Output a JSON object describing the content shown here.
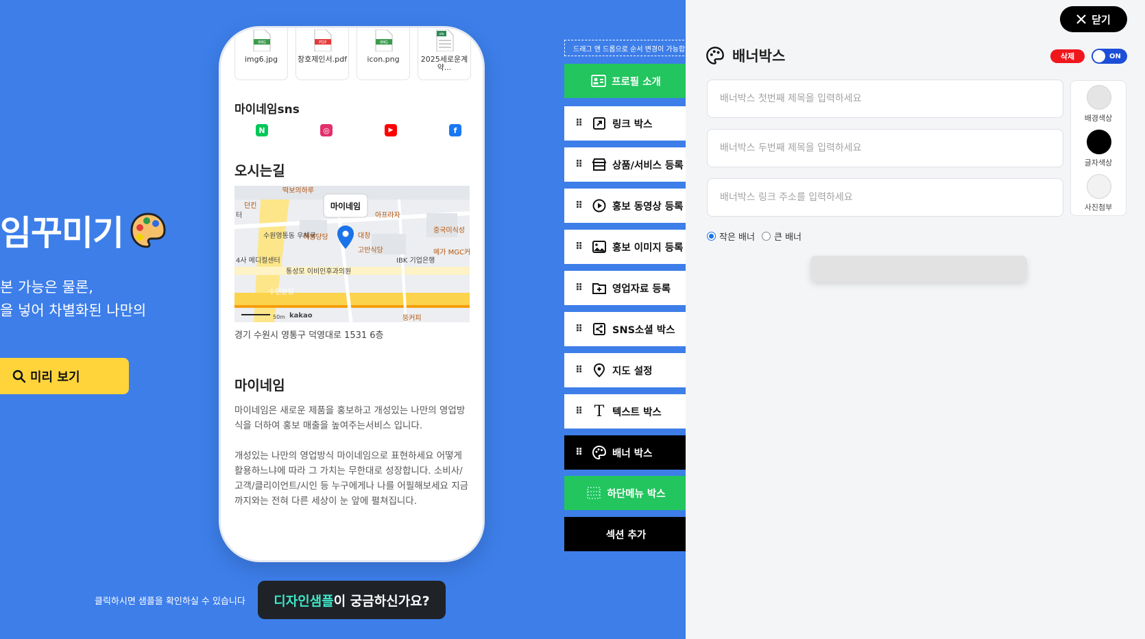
{
  "hero": {
    "title": "임꾸미기",
    "subtitle_line1": "본 가능은 물론,",
    "subtitle_line2": "을 넣어 차별화된 나만의",
    "preview_label": "미리 보기"
  },
  "phone": {
    "files": [
      {
        "name": "img6.jpg",
        "badge": "IMG",
        "color": "#3b9b4c"
      },
      {
        "name": "창호제인서.pdf",
        "badge": "PDF",
        "color": "#e23b3b"
      },
      {
        "name": "icon.png",
        "badge": "IMG",
        "color": "#3b9b4c"
      },
      {
        "name": "2025세로운계약...",
        "badge": "xls",
        "color": "#2e8b57"
      }
    ],
    "sns_title": "마이네임sns",
    "sns": [
      {
        "icon": "naver-icon",
        "glyph": "N",
        "color": "#03c75a"
      },
      {
        "icon": "instagram-icon",
        "glyph": "◎",
        "color": "#e1306c"
      },
      {
        "icon": "youtube-icon",
        "glyph": "▶",
        "color": "#ff0000"
      },
      {
        "icon": "facebook-icon",
        "glyph": "f",
        "color": "#1877f2"
      }
    ],
    "route_title": "오시는길",
    "map": {
      "pin_label": "마이네임",
      "labels": [
        "떡보의하루",
        "던킨",
        "터",
        "수원영통동 우체국",
        "어풍당당",
        "아프라자",
        "대창",
        "중국미식성",
        "고반식당",
        "4사 메디컬센터",
        "통성모 이비인후과의원",
        "IBK 기업은행",
        "메가 MGC커피",
        "수인분당",
        "뚱커피"
      ],
      "scale": "50m",
      "brand": "kakao"
    },
    "address": "경기 수원시 영통구 덕영대로 1531 6층",
    "brand_title": "마이네임",
    "desc_p1": "마이네임은 새로운 제품을 홍보하고 개성있는 나만의 영업방식을 더하여 홍보 매출을 높여주는서비스 입니다.",
    "desc_p2": "개성있는 나만의 영업방식 마이네임으로 표현하세요 어떻게 활용하느냐에 따라 그 가치는 무한대로 성장합니다. 소비사/고객/클리이언트/시인 등 누구에게나 나를 어필해보세요 지금까지와는 전혀 다른 세상이 눈 앞에 펼쳐집니다."
  },
  "bottom": {
    "note": "클릭하시면 샘플을 확인하실 수 있습니다",
    "design_hl": "디자인샘플",
    "design_rest": "이 궁금하신가요?"
  },
  "menu": {
    "drag_hint": "드래그 앤 드롭으로 순서 변경이 가능합니다",
    "items": [
      {
        "label": "프로필 소개",
        "icon": "profile-card-icon"
      },
      {
        "label": "링크 박스",
        "icon": "link-icon"
      },
      {
        "label": "상품/서비스 등록",
        "icon": "store-icon"
      },
      {
        "label": "홍보 동영상 등록",
        "icon": "play-icon"
      },
      {
        "label": "홍보 이미지 등록",
        "icon": "image-icon"
      },
      {
        "label": "영업자료 등록",
        "icon": "folder-icon"
      },
      {
        "label": "SNS소셜 박스",
        "icon": "share-icon"
      },
      {
        "label": "지도 설정",
        "icon": "map-pin-icon"
      },
      {
        "label": "텍스트 박스",
        "icon": "text-icon"
      },
      {
        "label": "배너 박스",
        "icon": "palette-icon"
      },
      {
        "label": "하단메뉴 박스",
        "icon": "grid-icon"
      },
      {
        "label": "섹션 추가",
        "icon": ""
      }
    ]
  },
  "panel": {
    "close_label": "닫기",
    "title": "배너박스",
    "delete_label": "삭제",
    "toggle_label": "ON",
    "field1_placeholder": "배너박스 첫번째 제목을 입력하세요",
    "field2_placeholder": "배너박스 두번째 제목을 입력하세요",
    "field3_placeholder": "배너박스 링크 주소를 입력하세요",
    "bg_color_label": "배경색상",
    "text_color_label": "글자색상",
    "photo_label": "사진첨부",
    "radio_small": "작은 배너",
    "radio_large": "큰 배너",
    "colors": {
      "bg": "#e5e5e5",
      "text": "#000000",
      "photo": "#f2f2f2"
    }
  },
  "colors": {
    "background": "#3d7ee9",
    "accent_green": "#22c55e",
    "accent_yellow": "#ffd43b",
    "danger": "#f0171c",
    "toggle": "#1d4ed8"
  }
}
